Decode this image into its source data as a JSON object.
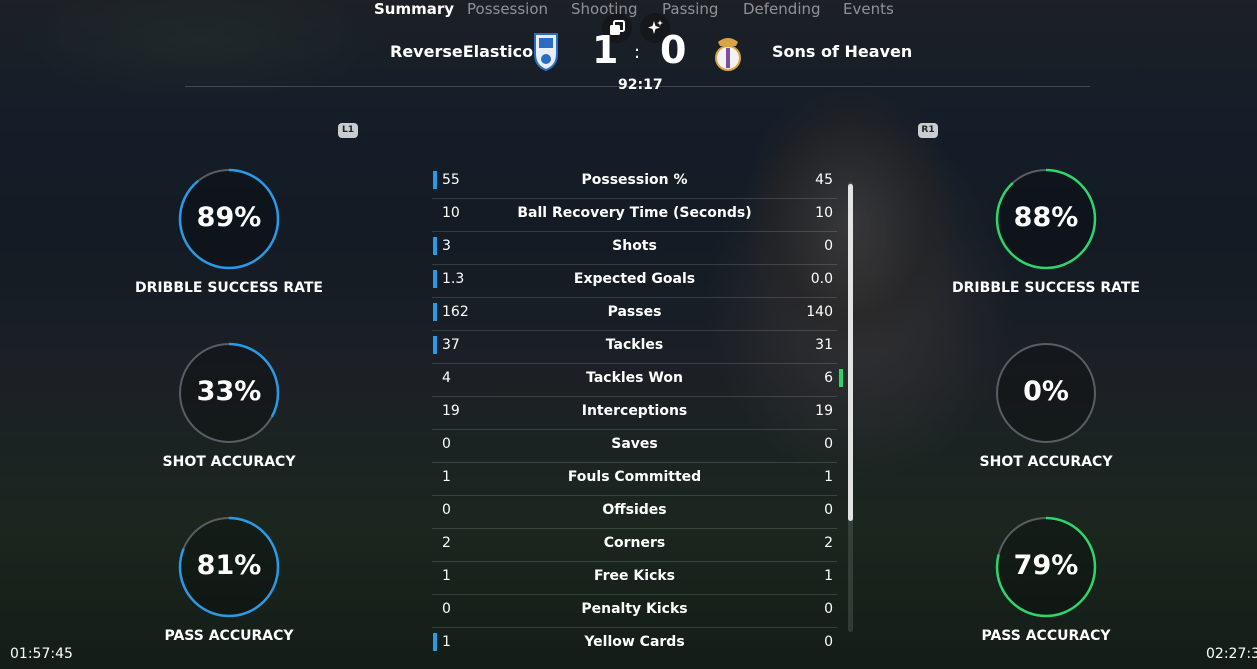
{
  "header": {
    "home_team": "ReverseElastico",
    "away_team": "Sons of Heaven",
    "home_score": "1",
    "away_score": "0",
    "separator": ":",
    "clock": "92:17"
  },
  "tabs": {
    "left_button": "L1",
    "right_button": "R1",
    "items": [
      "Summary",
      "Possession",
      "Shooting",
      "Passing",
      "Defending",
      "Events"
    ],
    "active": "Summary"
  },
  "home_rings": [
    {
      "value": "89%",
      "label": "DRIBBLE SUCCESS RATE",
      "fraction": 0.89
    },
    {
      "value": "33%",
      "label": "SHOT ACCURACY",
      "fraction": 0.33
    },
    {
      "value": "81%",
      "label": "PASS ACCURACY",
      "fraction": 0.81
    }
  ],
  "away_rings": [
    {
      "value": "88%",
      "label": "DRIBBLE SUCCESS RATE",
      "fraction": 0.88
    },
    {
      "value": "0%",
      "label": "SHOT ACCURACY",
      "fraction": 0.0
    },
    {
      "value": "79%",
      "label": "PASS ACCURACY",
      "fraction": 0.79
    }
  ],
  "stats": [
    {
      "home": "55",
      "name": "Possession %",
      "away": "45",
      "leader": "home"
    },
    {
      "home": "10",
      "name": "Ball Recovery Time (Seconds)",
      "away": "10",
      "leader": "none"
    },
    {
      "home": "3",
      "name": "Shots",
      "away": "0",
      "leader": "home"
    },
    {
      "home": "1.3",
      "name": "Expected Goals",
      "away": "0.0",
      "leader": "home"
    },
    {
      "home": "162",
      "name": "Passes",
      "away": "140",
      "leader": "home"
    },
    {
      "home": "37",
      "name": "Tackles",
      "away": "31",
      "leader": "home"
    },
    {
      "home": "4",
      "name": "Tackles Won",
      "away": "6",
      "leader": "away"
    },
    {
      "home": "19",
      "name": "Interceptions",
      "away": "19",
      "leader": "none"
    },
    {
      "home": "0",
      "name": "Saves",
      "away": "0",
      "leader": "none"
    },
    {
      "home": "1",
      "name": "Fouls Committed",
      "away": "1",
      "leader": "none"
    },
    {
      "home": "0",
      "name": "Offsides",
      "away": "0",
      "leader": "none"
    },
    {
      "home": "2",
      "name": "Corners",
      "away": "2",
      "leader": "none"
    },
    {
      "home": "1",
      "name": "Free Kicks",
      "away": "1",
      "leader": "none"
    },
    {
      "home": "0",
      "name": "Penalty Kicks",
      "away": "0",
      "leader": "none"
    },
    {
      "home": "1",
      "name": "Yellow Cards",
      "away": "0",
      "leader": "home"
    }
  ],
  "colors": {
    "home_accent": "#2b9ae6",
    "away_accent": "#2fd46c",
    "ring_track": "#5a5e64"
  },
  "icons": {
    "top_left": "external-window-icon",
    "top_right": "sparkle-icon",
    "home_crest": "club-crest-icon",
    "away_crest": "club-crest-icon"
  },
  "timestamps": {
    "left": "01:57:45",
    "right": "02:27:3"
  }
}
